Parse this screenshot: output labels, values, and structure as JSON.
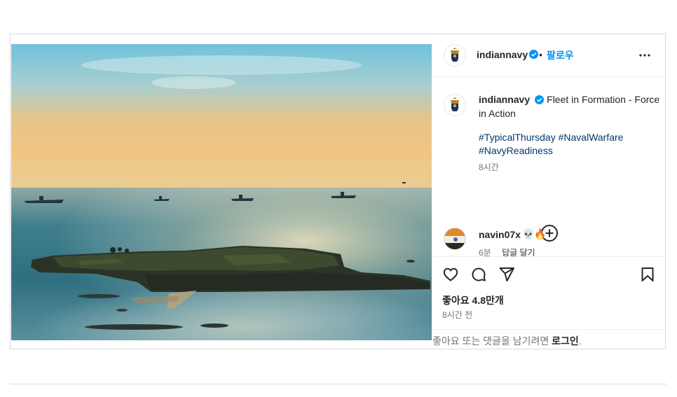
{
  "post": {
    "account": "indiannavy",
    "follow_label": "팔로우",
    "separator": "•",
    "caption": {
      "text": "Fleet in Formation - Force in Action",
      "hashtags": [
        "#TypicalThursday",
        "#NavalWarfare",
        "#NavyReadiness"
      ],
      "time": "8시간"
    },
    "comment": {
      "user": "navin07x",
      "text": "💀🔥",
      "time": "6분",
      "reply_label": "답글 달기"
    },
    "likes": "좋아요 4.8만개",
    "posted": "8시간 전",
    "login_prompt": {
      "text": "좋아요 또는 댓글을 남기려면 ",
      "link": "로그인",
      "suffix": "."
    }
  },
  "icons": {
    "verified": "verified-badge-icon",
    "more": "more-options-icon",
    "add_comment": "plus-circle-icon",
    "like": "heart-icon",
    "comment": "comment-bubble-icon",
    "share": "paper-plane-icon",
    "save": "bookmark-icon"
  },
  "colors": {
    "link_blue": "#0095f6",
    "hashtag": "#00376b",
    "border": "#dbdbdb",
    "muted": "#737373"
  }
}
